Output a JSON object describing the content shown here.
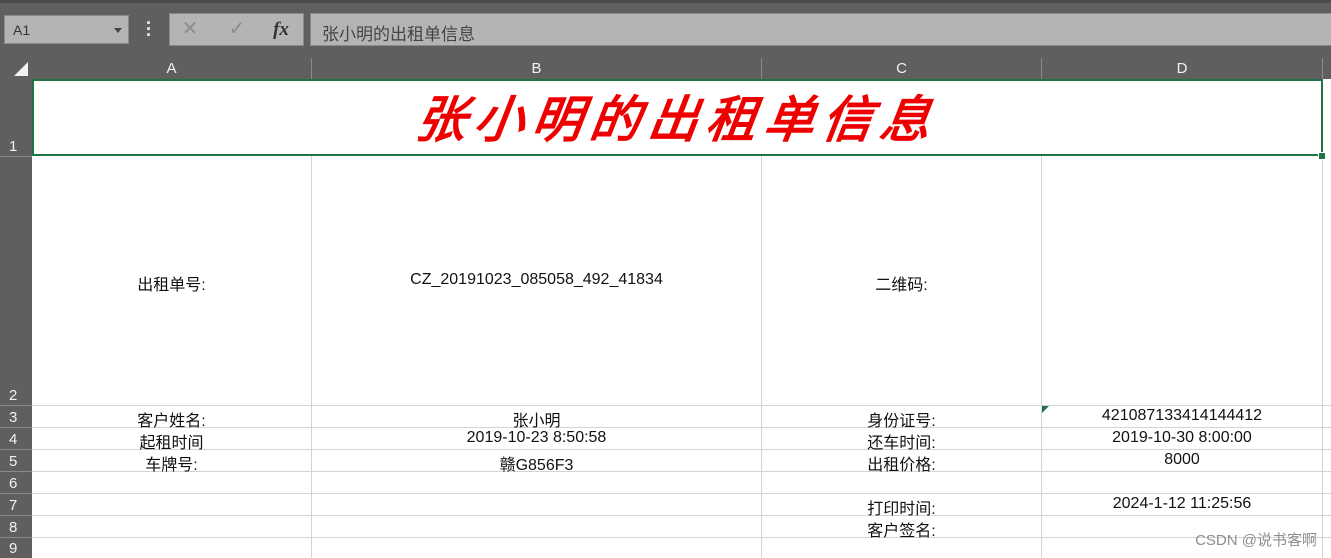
{
  "formula_bar": {
    "name_box": "A1",
    "cancel_icon": "✕",
    "enter_icon": "✓",
    "fx_label": "fx",
    "formula": "张小明的出租单信息"
  },
  "columns": [
    "A",
    "B",
    "C",
    "D"
  ],
  "rows": [
    "1",
    "2",
    "3",
    "4",
    "5",
    "6",
    "7",
    "8",
    "9"
  ],
  "sheet": {
    "title": "张小明的出租单信息",
    "title_color": "#ee0000",
    "selection_color": "#217346",
    "r2": {
      "a": "出租单号:",
      "b": "CZ_20191023_085058_492_41834",
      "c": "二维码:"
    },
    "r3": {
      "a": "客户姓名:",
      "b": "张小明",
      "c": "身份证号:",
      "d": "421087133414144412"
    },
    "r4": {
      "a": "起租时间",
      "b": "2019-10-23 8:50:58",
      "c": "还车时间:",
      "d": "2019-10-30 8:00:00"
    },
    "r5": {
      "a": "车牌号:",
      "b": "赣G856F3",
      "c": "出租价格:",
      "d": "8000"
    },
    "r7": {
      "c": "打印时间:",
      "d": "2024-1-12 11:25:56"
    },
    "r8": {
      "c": "客户签名:"
    }
  },
  "watermark": "CSDN @说书客啊"
}
